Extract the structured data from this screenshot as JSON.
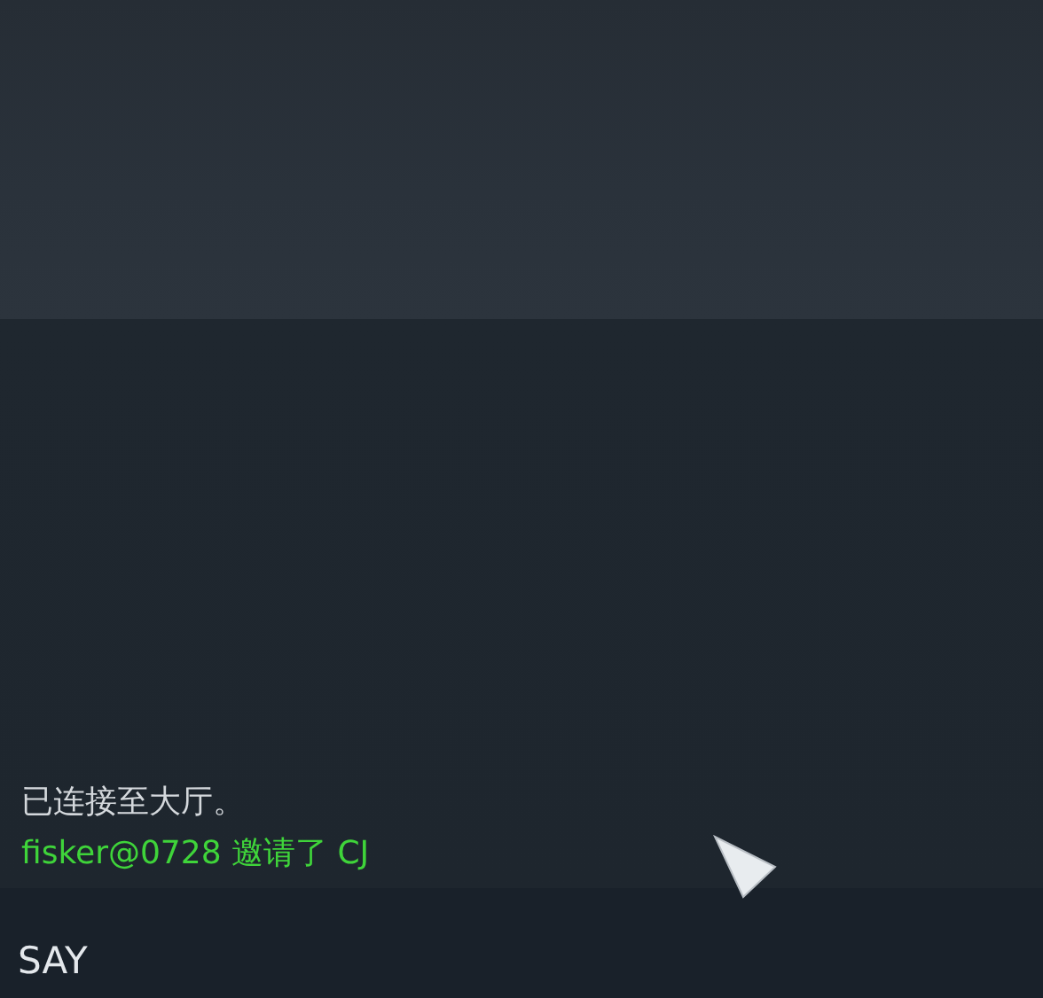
{
  "chat": {
    "messages": [
      {
        "kind": "system",
        "text": "已连接至大厅。"
      },
      {
        "kind": "invite",
        "text": "fisker@0728 邀请了 CJ"
      }
    ]
  },
  "input": {
    "label": "SAY"
  }
}
